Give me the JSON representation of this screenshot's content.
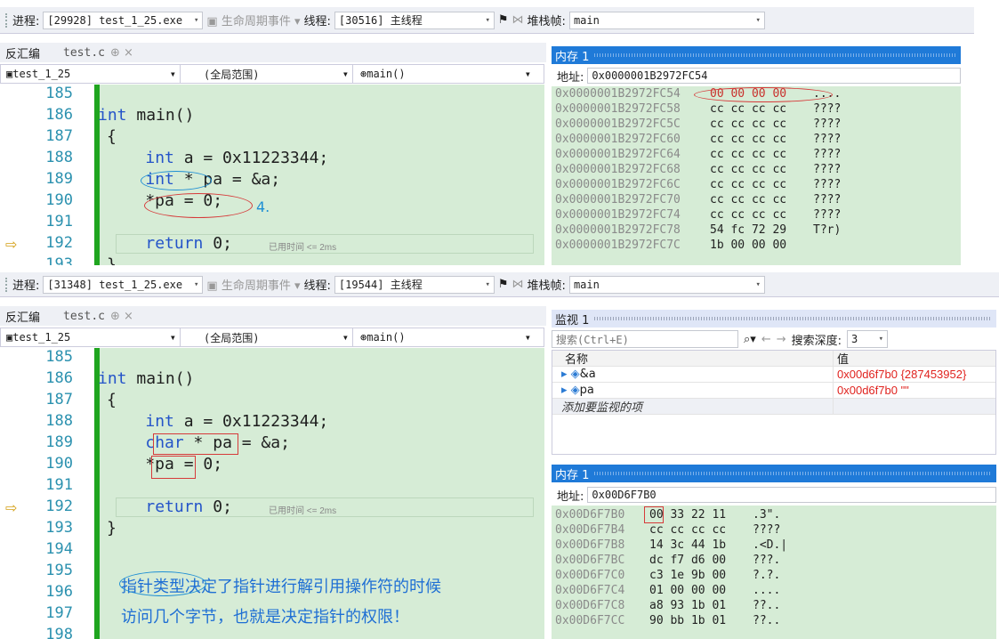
{
  "top": {
    "toolbar": {
      "process_label": "进程:",
      "process_value": "[29928] test_1_25.exe",
      "lifecycle_label": "生命周期事件",
      "thread_label": "线程:",
      "thread_value": "[30516] 主线程",
      "stackframe_label": "堆栈帧:",
      "stackframe_value": "main"
    },
    "left_tabs": {
      "disasm": "反汇编",
      "doc": "test.c",
      "pin": "⊕ ×"
    },
    "nav": {
      "project": "test_1_25",
      "scope": "(全局范围)",
      "func": "main()"
    },
    "lines": [
      "185",
      "186",
      "187",
      "188",
      "189",
      "190",
      "191",
      "192",
      "193"
    ],
    "code": [
      "",
      "int main()",
      "{",
      "    int a = 0x11223344;",
      "    int * pa = &a;",
      "    *pa = 0;",
      "",
      "    return 0;",
      "}"
    ],
    "elapsed": "已用时间 <= 2ms",
    "annotation_num": "4.",
    "memory": {
      "title": "内存 1",
      "addr_label": "地址:",
      "addr_value": "0x0000001B2972FC54",
      "rows": [
        {
          "a": "0x0000001B2972FC54",
          "b": "00 00 00 00",
          "c": "...."
        },
        {
          "a": "0x0000001B2972FC58",
          "b": "cc cc cc cc",
          "c": "????"
        },
        {
          "a": "0x0000001B2972FC5C",
          "b": "cc cc cc cc",
          "c": "????"
        },
        {
          "a": "0x0000001B2972FC60",
          "b": "cc cc cc cc",
          "c": "????"
        },
        {
          "a": "0x0000001B2972FC64",
          "b": "cc cc cc cc",
          "c": "????"
        },
        {
          "a": "0x0000001B2972FC68",
          "b": "cc cc cc cc",
          "c": "????"
        },
        {
          "a": "0x0000001B2972FC6C",
          "b": "cc cc cc cc",
          "c": "????"
        },
        {
          "a": "0x0000001B2972FC70",
          "b": "cc cc cc cc",
          "c": "????"
        },
        {
          "a": "0x0000001B2972FC74",
          "b": "cc cc cc cc",
          "c": "????"
        },
        {
          "a": "0x0000001B2972FC78",
          "b": "54 fc 72 29",
          "c": "T?r)"
        },
        {
          "a": "0x0000001B2972FC7C",
          "b": "1b 00 00 00",
          "c": ""
        }
      ]
    }
  },
  "bottom": {
    "toolbar": {
      "process_label": "进程:",
      "process_value": "[31348] test_1_25.exe",
      "lifecycle_label": "生命周期事件",
      "thread_label": "线程:",
      "thread_value": "[19544] 主线程",
      "stackframe_label": "堆栈帧:",
      "stackframe_value": "main"
    },
    "left_tabs": {
      "disasm": "反汇编",
      "doc": "test.c",
      "pin": "⊕ ×"
    },
    "nav": {
      "project": "test_1_25",
      "scope": "(全局范围)",
      "func": "main()"
    },
    "lines": [
      "185",
      "186",
      "187",
      "188",
      "189",
      "190",
      "191",
      "192",
      "193",
      "194",
      "195",
      "196",
      "197",
      "198"
    ],
    "code": [
      "",
      "int main()",
      "{",
      "    int a = 0x11223344;",
      "    char * pa = &a;",
      "    *pa = 0;",
      "",
      "    return 0;",
      "}",
      "",
      "",
      "",
      "",
      ""
    ],
    "elapsed": "已用时间 <= 2ms",
    "note_line1": "指针类型决定了指针进行解引用操作符的时候",
    "note_line2": "访问几个字节，也就是决定指针的权限！",
    "watch": {
      "title": "监视 1",
      "search_placeholder": "搜索(Ctrl+E)",
      "depth_label": "搜索深度:",
      "depth_value": "3",
      "col_name": "名称",
      "col_value": "值",
      "rows": [
        {
          "name": "&a",
          "value": "0x00d6f7b0 {287453952}"
        },
        {
          "name": "pa",
          "value": "0x00d6f7b0 \"\""
        }
      ],
      "add_item": "添加要监视的项"
    },
    "memory": {
      "title": "内存 1",
      "addr_label": "地址:",
      "addr_value": "0x00D6F7B0",
      "rows": [
        {
          "a": "0x00D6F7B0",
          "b": "00 33 22 11",
          "c": ".3\"."
        },
        {
          "a": "0x00D6F7B4",
          "b": "cc cc cc cc",
          "c": "????"
        },
        {
          "a": "0x00D6F7B8",
          "b": "14 3c 44 1b",
          "c": ".<D.|"
        },
        {
          "a": "0x00D6F7BC",
          "b": "dc f7 d6 00",
          "c": "???."
        },
        {
          "a": "0x00D6F7C0",
          "b": "c3 1e 9b 00",
          "c": "?.?."
        },
        {
          "a": "0x00D6F7C4",
          "b": "01 00 00 00",
          "c": "...."
        },
        {
          "a": "0x00D6F7C8",
          "b": "a8 93 1b 01",
          "c": "??.."
        },
        {
          "a": "0x00D6F7CC",
          "b": "90 bb 1b 01",
          "c": "??.."
        }
      ]
    }
  }
}
